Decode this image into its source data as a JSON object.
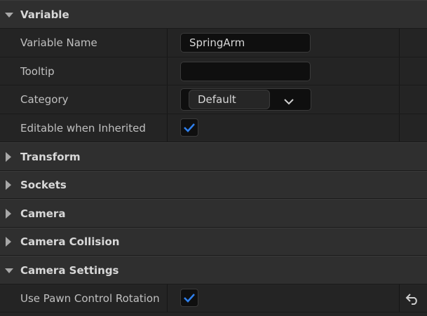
{
  "sections": {
    "variable": "Variable",
    "transform": "Transform",
    "sockets": "Sockets",
    "camera": "Camera",
    "camera_collision": "Camera Collision",
    "camera_settings": "Camera Settings"
  },
  "variable_props": {
    "name_label": "Variable Name",
    "name_value": "SpringArm",
    "tooltip_label": "Tooltip",
    "tooltip_value": "",
    "category_label": "Category",
    "category_value": "Default",
    "editable_label": "Editable when Inherited",
    "editable_checked": true
  },
  "camera_settings_props": {
    "use_pawn_label": "Use Pawn Control Rotation",
    "use_pawn_checked": true
  },
  "colors": {
    "check": "#2f80ed",
    "panel_bg": "#242424",
    "category_bg": "#2f2f2f"
  },
  "icons": {
    "expanded": "triangle-down-icon",
    "collapsed": "triangle-right-icon",
    "check": "checkmark-icon",
    "reset": "reset-arrow-icon",
    "dropdown": "chevron-down-icon"
  }
}
